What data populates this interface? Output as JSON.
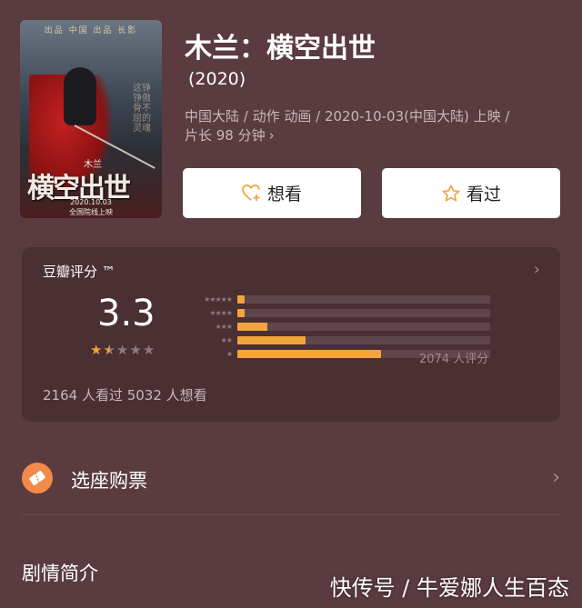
{
  "movie": {
    "title": "木兰：横空出世",
    "year": "(2020)",
    "meta_line1": "中国大陆 / 动作 动画 / 2020-10-03(中国大陆) 上映 /",
    "meta_line2": "片长 98 分钟",
    "poster": {
      "top_text": "出品 中国    出品 长影",
      "small_title": "木兰",
      "big_title": "横空出世",
      "date": "2020.10.03",
      "release": "全国院线上映",
      "vertical_text": "这铮铮傲骨不屈的灵魂"
    }
  },
  "buttons": {
    "want": "想看",
    "seen": "看过"
  },
  "rating": {
    "label": "豆瓣评分 ™",
    "score": "3.3",
    "stars": 1.5,
    "distribution": [
      {
        "stars": "★★★★★",
        "percent": 3
      },
      {
        "stars": "★★★★",
        "percent": 3
      },
      {
        "stars": "★★★",
        "percent": 12
      },
      {
        "stars": "★★",
        "percent": 27
      },
      {
        "stars": "★",
        "percent": 57
      }
    ],
    "count_text": "2074 人评分",
    "watch_stats": "2164 人看过   5032 人想看"
  },
  "ticket": {
    "label": "选座购票"
  },
  "plot": {
    "title": "剧情简介"
  },
  "watermark": "快传号 / 牛爱娜人生百态",
  "colors": {
    "background": "#5a3b3f",
    "accent": "#f3a43d",
    "ticket": "#f38a4a"
  }
}
